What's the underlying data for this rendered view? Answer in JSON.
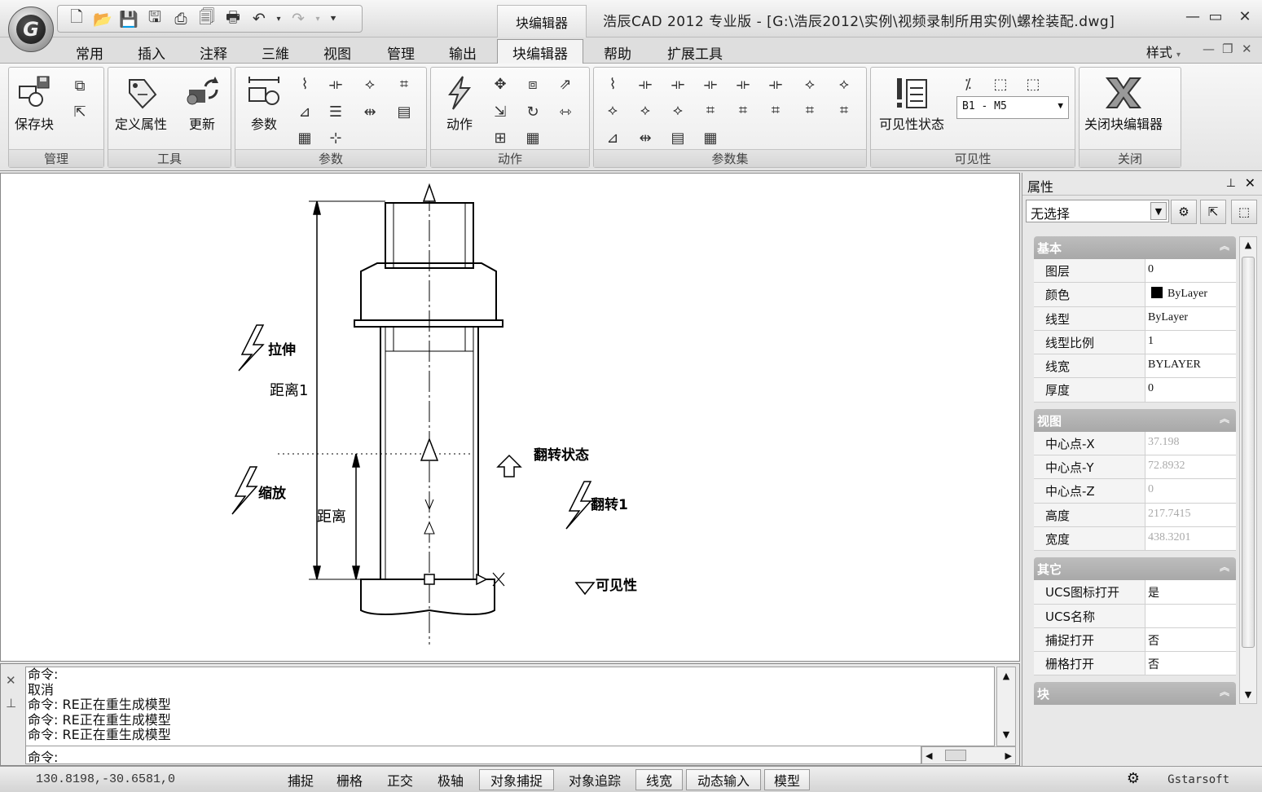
{
  "app": {
    "window_title": "浩辰CAD  2012  专业版 - [G:\\浩辰2012\\实例\\视频录制所用实例\\螺栓装配.dwg]",
    "context_tab_title": "块编辑器",
    "logo_letter": "G"
  },
  "ribbon_tabs": [
    "常用",
    "插入",
    "注释",
    "三維",
    "视图",
    "管理",
    "输出",
    "块编辑器",
    "帮助",
    "扩展工具"
  ],
  "active_tab": "块编辑器",
  "style_menu": "样式",
  "panels": {
    "manage": {
      "label": "管理",
      "save_block": "保存块"
    },
    "tools": {
      "label": "工具",
      "define_attr": "定义属性",
      "update": "更新"
    },
    "params": {
      "label": "参数",
      "param": "参数"
    },
    "actions": {
      "label": "动作",
      "action": "动作"
    },
    "param_sets": {
      "label": "参数集"
    },
    "visibility": {
      "label": "可见性",
      "vis_state": "可见性状态",
      "dropdown_value": "B1 - M5"
    },
    "close": {
      "label": "关闭",
      "close_editor": "关闭块编辑器"
    }
  },
  "drawing": {
    "labels": {
      "stretch": "拉伸",
      "distance1": "距离1",
      "scale": "缩放",
      "distance": "距离",
      "flip_state": "翻转状态",
      "flip1": "翻转1",
      "visibility": "可见性"
    }
  },
  "properties": {
    "title": "属性",
    "selection": "无选择",
    "categories": [
      {
        "name": "基本",
        "rows": [
          {
            "key": "图层",
            "value": "0"
          },
          {
            "key": "颜色",
            "value": "ByLayer",
            "swatch": "#000000"
          },
          {
            "key": "线型",
            "value": "ByLayer"
          },
          {
            "key": "线型比例",
            "value": "1"
          },
          {
            "key": "线宽",
            "value": "BYLAYER"
          },
          {
            "key": "厚度",
            "value": "0"
          }
        ]
      },
      {
        "name": "视图",
        "rows": [
          {
            "key": "中心点-X",
            "value": "37.198",
            "readonly": true
          },
          {
            "key": "中心点-Y",
            "value": "72.8932",
            "readonly": true
          },
          {
            "key": "中心点-Z",
            "value": "0",
            "readonly": true
          },
          {
            "key": "高度",
            "value": "217.7415",
            "readonly": true
          },
          {
            "key": "宽度",
            "value": "438.3201",
            "readonly": true
          }
        ]
      },
      {
        "name": "其它",
        "rows": [
          {
            "key": "UCS图标打开",
            "value": "是"
          },
          {
            "key": "UCS名称",
            "value": ""
          },
          {
            "key": "捕捉打开",
            "value": "否"
          },
          {
            "key": "栅格打开",
            "value": "否"
          }
        ]
      },
      {
        "name": "块",
        "rows": []
      }
    ]
  },
  "command": {
    "history": [
      "命令:",
      "取消",
      "命令: RE正在重生成模型",
      "命令: RE正在重生成模型",
      "命令: RE正在重生成模型"
    ],
    "prompt": "命令:"
  },
  "status": {
    "coords": "130.8198,-30.6581,0",
    "buttons": [
      {
        "label": "捕捉",
        "on": false
      },
      {
        "label": "栅格",
        "on": false
      },
      {
        "label": "正交",
        "on": false
      },
      {
        "label": "极轴",
        "on": false
      },
      {
        "label": "对象捕捉",
        "on": true
      },
      {
        "label": "对象追踪",
        "on": false
      },
      {
        "label": "线宽",
        "on": true
      },
      {
        "label": "动态输入",
        "on": true
      },
      {
        "label": "模型",
        "on": true
      }
    ],
    "brand": "Gstarsoft"
  }
}
